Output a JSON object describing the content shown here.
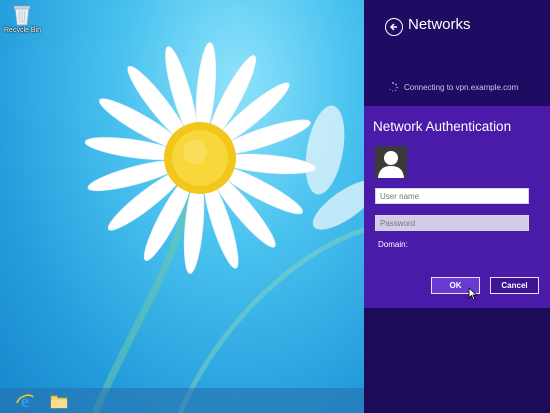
{
  "desktop": {
    "recycle_bin_label": "Recycle Bin",
    "taskbar": {
      "items": [
        "internet-explorer",
        "file-explorer"
      ]
    }
  },
  "charm": {
    "title": "Networks",
    "status": "Connecting to vpn.example.com"
  },
  "auth": {
    "title": "Network Authentication",
    "username_placeholder": "User name",
    "password_placeholder": "Password",
    "domain_label": "Domain:",
    "ok_label": "OK",
    "cancel_label": "Cancel"
  },
  "colors": {
    "charm_bg": "#1c0b59",
    "auth_bg": "#4a1ba8",
    "ok_bg": "#6b3bd0"
  }
}
